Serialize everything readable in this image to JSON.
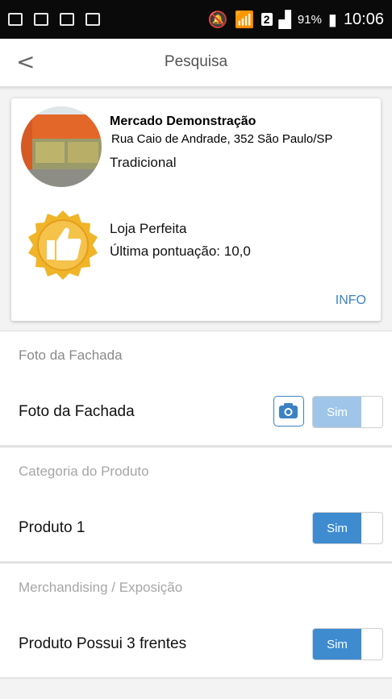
{
  "status_bar": {
    "battery": "91%",
    "time": "10:06",
    "sim_slot": "2"
  },
  "app_bar": {
    "back_label": "<",
    "title": "Pesquisa"
  },
  "store_card": {
    "name": "Mercado Demonstração",
    "address": "Rua Caio de Andrade, 352 São Paulo/SP",
    "type": "Tradicional",
    "badge_title": "Loja Perfeita",
    "badge_score": "Última pontuação: 10,0",
    "info_label": "INFO"
  },
  "sections": [
    {
      "header": "Foto da Fachada",
      "items": [
        {
          "label": "Foto da Fachada",
          "has_camera": true,
          "toggle_label": "Sim",
          "toggle_on": true,
          "enabled": false
        }
      ]
    },
    {
      "header": "Categoria do Produto",
      "items": [
        {
          "label": "Produto 1",
          "has_camera": false,
          "toggle_label": "Sim",
          "toggle_on": true,
          "enabled": true
        }
      ]
    },
    {
      "header": "Merchandising / Exposição",
      "items": [
        {
          "label": "Produto Possui 3 frentes",
          "has_camera": false,
          "toggle_label": "Sim",
          "toggle_on": true,
          "enabled": true
        }
      ]
    }
  ],
  "colors": {
    "accent": "#3e8bd0",
    "accent_disabled": "#9fc6e8",
    "link": "#3b82c4",
    "badge_gold": "#f2b730"
  }
}
